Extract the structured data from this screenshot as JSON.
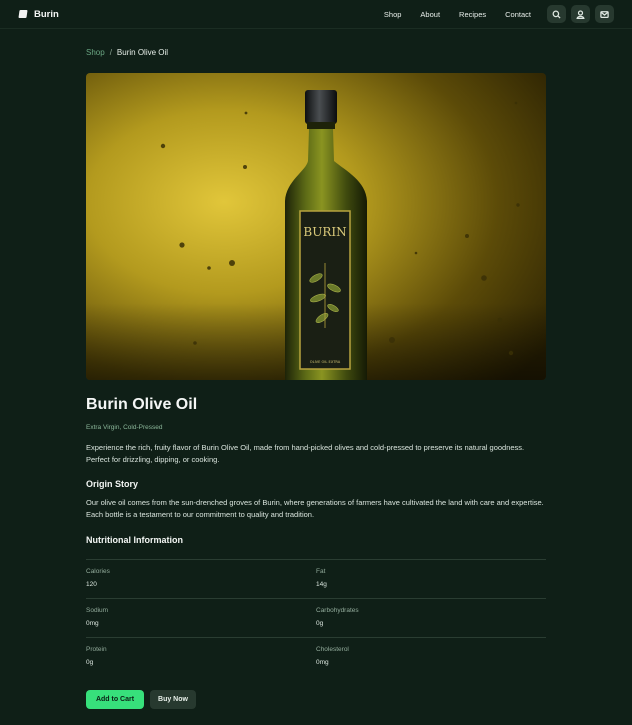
{
  "header": {
    "brand": "Burin",
    "nav": [
      "Shop",
      "About",
      "Recipes",
      "Contact"
    ],
    "icons": [
      "search-icon",
      "user-icon",
      "mail-icon"
    ]
  },
  "breadcrumb": {
    "parent": "Shop",
    "separator": "/",
    "current": "Burin Olive Oil"
  },
  "hero": {
    "label_text": "BURIN",
    "label_small": "OLIVE OIL EXTRA"
  },
  "product": {
    "title": "Burin Olive Oil",
    "subtitle": "Extra Virgin, Cold-Pressed",
    "description": "Experience the rich, fruity flavor of Burin Olive Oil, made from hand-picked olives and cold-pressed to preserve its natural goodness. Perfect for drizzling, dipping, or cooking."
  },
  "origin": {
    "title": "Origin Story",
    "text": "Our olive oil comes from the sun-drenched groves of Burin, where generations of farmers have cultivated the land with care and expertise. Each bottle is a testament to our commitment to quality and tradition."
  },
  "nutrition": {
    "title": "Nutritional Information",
    "rows": [
      [
        {
          "label": "Calories",
          "value": "120"
        },
        {
          "label": "Fat",
          "value": "14g"
        }
      ],
      [
        {
          "label": "Sodium",
          "value": "0mg"
        },
        {
          "label": "Carbohydrates",
          "value": "0g"
        }
      ],
      [
        {
          "label": "Protein",
          "value": "0g"
        },
        {
          "label": "Cholesterol",
          "value": "0mg"
        }
      ]
    ]
  },
  "actions": {
    "add_to_cart": "Add to Cart",
    "buy_now": "Buy Now"
  },
  "colors": {
    "background": "#0f1f17",
    "accent": "#37e07b",
    "button_secondary": "#27392f"
  }
}
